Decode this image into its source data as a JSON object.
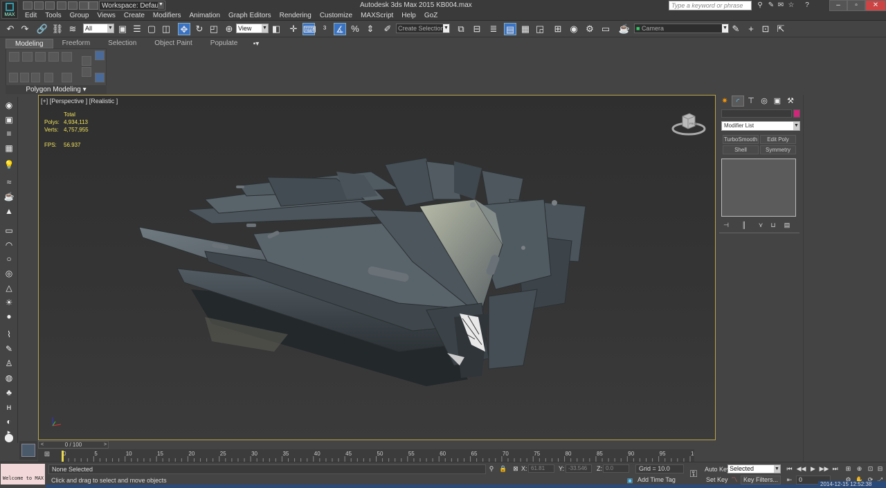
{
  "window": {
    "app_title": "Autodesk 3ds Max  2015      KB004.max",
    "logo_text": "MAX",
    "workspace_label": "Workspace: Default",
    "search_placeholder": "Type a keyword or phrase"
  },
  "menu": [
    "Edit",
    "Tools",
    "Group",
    "Views",
    "Create",
    "Modifiers",
    "Animation",
    "Graph Editors",
    "Rendering",
    "Customize",
    "MAXScript",
    "Help",
    "GoZ"
  ],
  "toolbar": {
    "selection_filter": "All",
    "reference_coord": "View",
    "named_selection_placeholder": "Create Selection Se",
    "camera_placeholder": "Camera"
  },
  "ribbon": {
    "tabs": [
      "Modeling",
      "Freeform",
      "Selection",
      "Object Paint",
      "Populate"
    ],
    "active_tab": "Modeling",
    "panel_label": "Polygon Modeling"
  },
  "viewport": {
    "label": "[+] [Perspective ] [Realistic ]",
    "stats": {
      "header": "Total",
      "polys_label": "Polys:",
      "polys_value": "4,934,113",
      "verts_label": "Verts:",
      "verts_value": "4,757,955",
      "fps_label": "FPS:",
      "fps_value": "56.937"
    },
    "viewcube_face": "FRONT"
  },
  "command_panel": {
    "modifier_list_label": "Modifier List",
    "modifier_buttons": [
      "TurboSmooth",
      "Edit Poly",
      "Shell",
      "Symmetry"
    ],
    "object_color": "#d2267b"
  },
  "timeline": {
    "slider_label": "0 / 100",
    "ticks": [
      0,
      5,
      10,
      15,
      20,
      25,
      30,
      35,
      40,
      45,
      50,
      55,
      60,
      65,
      70,
      75,
      80,
      85,
      90,
      95,
      100
    ],
    "range": [
      0,
      100
    ],
    "current_frame": 0
  },
  "status": {
    "welcome_text": "Welcome to MAX",
    "selection_status": "None Selected",
    "prompt": "Click and drag to select and move objects",
    "x_label": "X:",
    "x_value": "61.81",
    "y_label": "Y:",
    "y_value": "-33.546",
    "z_label": "Z:",
    "z_value": "0.0",
    "grid": "Grid = 10.0",
    "add_time_tag": "Add Time Tag",
    "auto_key": "Auto Key",
    "set_key": "Set Key",
    "key_mode": "Selected",
    "key_filters": "Key Filters...",
    "frame_value": "0",
    "clock": "2014-12-15   12:52:38"
  }
}
